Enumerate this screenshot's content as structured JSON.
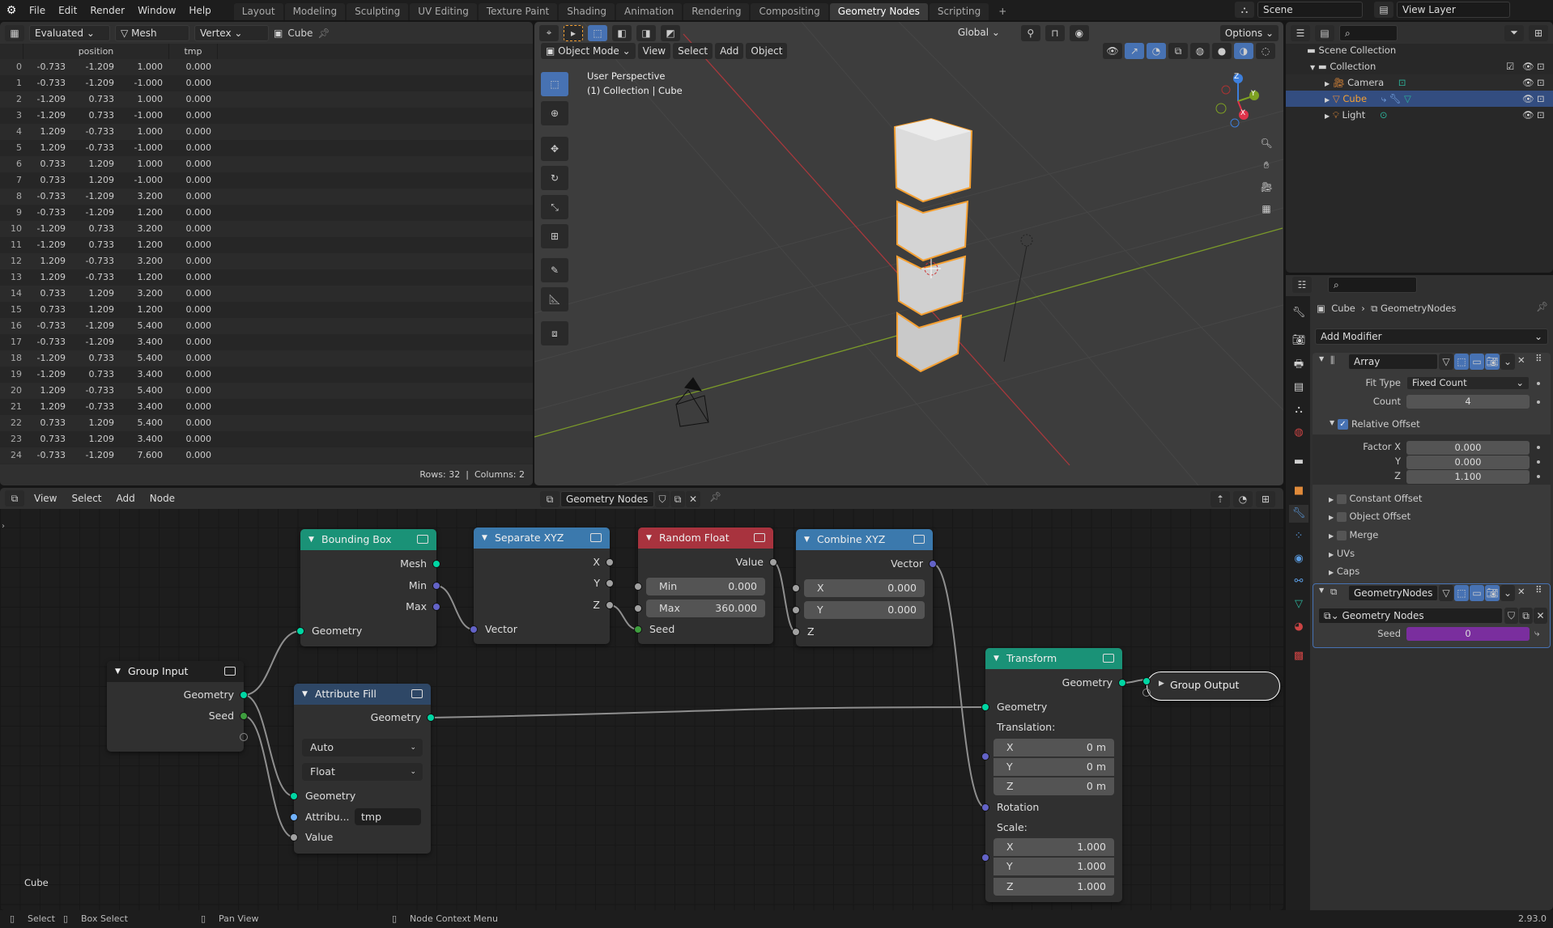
{
  "topbar": {
    "menus": [
      "File",
      "Edit",
      "Render",
      "Window",
      "Help"
    ],
    "workspaces": [
      "Layout",
      "Modeling",
      "Sculpting",
      "UV Editing",
      "Texture Paint",
      "Shading",
      "Animation",
      "Rendering",
      "Compositing",
      "Geometry Nodes",
      "Scripting"
    ],
    "active_workspace": "Geometry Nodes",
    "add_workspace": "+",
    "scene": "Scene",
    "view_layer": "View Layer"
  },
  "spreadsheet": {
    "mode": "Evaluated",
    "geometry_type": "Mesh",
    "domain": "Vertex",
    "object": "Cube",
    "columns": [
      "position",
      "tmp"
    ],
    "rows": [
      [
        "0",
        "-0.733",
        "-1.209",
        "1.000",
        "0.000"
      ],
      [
        "1",
        "-0.733",
        "-1.209",
        "-1.000",
        "0.000"
      ],
      [
        "2",
        "-1.209",
        "0.733",
        "1.000",
        "0.000"
      ],
      [
        "3",
        "-1.209",
        "0.733",
        "-1.000",
        "0.000"
      ],
      [
        "4",
        "1.209",
        "-0.733",
        "1.000",
        "0.000"
      ],
      [
        "5",
        "1.209",
        "-0.733",
        "-1.000",
        "0.000"
      ],
      [
        "6",
        "0.733",
        "1.209",
        "1.000",
        "0.000"
      ],
      [
        "7",
        "0.733",
        "1.209",
        "-1.000",
        "0.000"
      ],
      [
        "8",
        "-0.733",
        "-1.209",
        "3.200",
        "0.000"
      ],
      [
        "9",
        "-0.733",
        "-1.209",
        "1.200",
        "0.000"
      ],
      [
        "10",
        "-1.209",
        "0.733",
        "3.200",
        "0.000"
      ],
      [
        "11",
        "-1.209",
        "0.733",
        "1.200",
        "0.000"
      ],
      [
        "12",
        "1.209",
        "-0.733",
        "3.200",
        "0.000"
      ],
      [
        "13",
        "1.209",
        "-0.733",
        "1.200",
        "0.000"
      ],
      [
        "14",
        "0.733",
        "1.209",
        "3.200",
        "0.000"
      ],
      [
        "15",
        "0.733",
        "1.209",
        "1.200",
        "0.000"
      ],
      [
        "16",
        "-0.733",
        "-1.209",
        "5.400",
        "0.000"
      ],
      [
        "17",
        "-0.733",
        "-1.209",
        "3.400",
        "0.000"
      ],
      [
        "18",
        "-1.209",
        "0.733",
        "5.400",
        "0.000"
      ],
      [
        "19",
        "-1.209",
        "0.733",
        "3.400",
        "0.000"
      ],
      [
        "20",
        "1.209",
        "-0.733",
        "5.400",
        "0.000"
      ],
      [
        "21",
        "1.209",
        "-0.733",
        "3.400",
        "0.000"
      ],
      [
        "22",
        "0.733",
        "1.209",
        "5.400",
        "0.000"
      ],
      [
        "23",
        "0.733",
        "1.209",
        "3.400",
        "0.000"
      ],
      [
        "24",
        "-0.733",
        "-1.209",
        "7.600",
        "0.000"
      ]
    ],
    "footer": {
      "rows": "Rows: 32",
      "separator": "|",
      "columns": "Columns: 2"
    }
  },
  "viewport": {
    "transform_orientation": "Global",
    "options": "Options",
    "mode": "Object Mode",
    "menus": [
      "View",
      "Select",
      "Add",
      "Object"
    ],
    "view_name": "User Perspective",
    "view_context": "(1) Collection | Cube",
    "gizmo_axes": [
      "X",
      "Y",
      "Z"
    ],
    "colors": {
      "x_axis": "#c0383f",
      "y_axis": "#7ea122",
      "selection": "#f5a032"
    }
  },
  "outliner": {
    "items": [
      {
        "label": "Scene Collection"
      },
      {
        "label": "Collection"
      },
      {
        "label": "Camera"
      },
      {
        "label": "Cube",
        "selected": true
      },
      {
        "label": "Light"
      }
    ]
  },
  "properties": {
    "breadcrumb": {
      "object": "Cube",
      "modifier": "GeometryNodes"
    },
    "add_modifier": "Add Modifier",
    "array": {
      "name": "Array",
      "fit_type_label": "Fit Type",
      "fit_type": "Fixed Count",
      "count_label": "Count",
      "count": "4",
      "relative_offset": {
        "label": "Relative Offset",
        "checked": true,
        "factor_x_label": "Factor X",
        "factor_x": "0.000",
        "y_label": "Y",
        "y": "0.000",
        "z_label": "Z",
        "z": "1.100"
      },
      "subpanels": [
        "Constant Offset",
        "Object Offset",
        "Merge",
        "UVs",
        "Caps"
      ]
    },
    "geometry_nodes": {
      "name": "GeometryNodes",
      "node_group": "Geometry Nodes",
      "seed_label": "Seed",
      "seed": "0",
      "seed_color": "#7a2e9e"
    }
  },
  "node_editor": {
    "menus": [
      "View",
      "Select",
      "Add",
      "Node"
    ],
    "node_group": "Geometry Nodes",
    "context_label": "Cube",
    "nodes": {
      "bounding_box": {
        "title": "Bounding Box",
        "outputs": [
          "Mesh",
          "Min",
          "Max"
        ],
        "inputs": [
          "Geometry"
        ]
      },
      "separate_xyz": {
        "title": "Separate XYZ",
        "outputs": [
          "X",
          "Y",
          "Z"
        ],
        "inputs": [
          "Vector"
        ]
      },
      "random_float": {
        "title": "Random Float",
        "outputs": [
          "Value"
        ],
        "min_label": "Min",
        "min": "0.000",
        "max_label": "Max",
        "max": "360.000",
        "seed_label": "Seed"
      },
      "combine_xyz": {
        "title": "Combine XYZ",
        "outputs": [
          "Vector"
        ],
        "x_label": "X",
        "x": "0.000",
        "y_label": "Y",
        "y": "0.000",
        "z_label": "Z"
      },
      "group_input": {
        "title": "Group Input",
        "outputs": [
          "Geometry",
          "Seed"
        ]
      },
      "attribute_fill": {
        "title": "Attribute Fill",
        "output": "Geometry",
        "domain": "Auto",
        "data_type": "Float",
        "inputs": [
          "Geometry",
          "Attribu...",
          "Value"
        ],
        "attribute_value": "tmp"
      },
      "transform": {
        "title": "Transform",
        "output": "Geometry",
        "input_geometry": "Geometry",
        "translation_label": "Translation:",
        "translation": [
          "0 m",
          "0 m",
          "0 m"
        ],
        "rotation_label": "Rotation",
        "scale_label": "Scale:",
        "scale": [
          "1.000",
          "1.000",
          "1.000"
        ],
        "axes": [
          "X",
          "Y",
          "Z"
        ]
      },
      "group_output": {
        "title": "Group Output"
      }
    },
    "colors": {
      "geometry_socket": "#00d6a3",
      "vector_socket": "#6363c7",
      "float_socket": "#a1a1a1",
      "int_socket": "#3e9e3e",
      "string_socket": "#70b2ff"
    }
  },
  "statusbar": {
    "select": "Select",
    "box_select": "Box Select",
    "pan_view": "Pan View",
    "context_menu": "Node Context Menu",
    "version": "2.93.0"
  }
}
